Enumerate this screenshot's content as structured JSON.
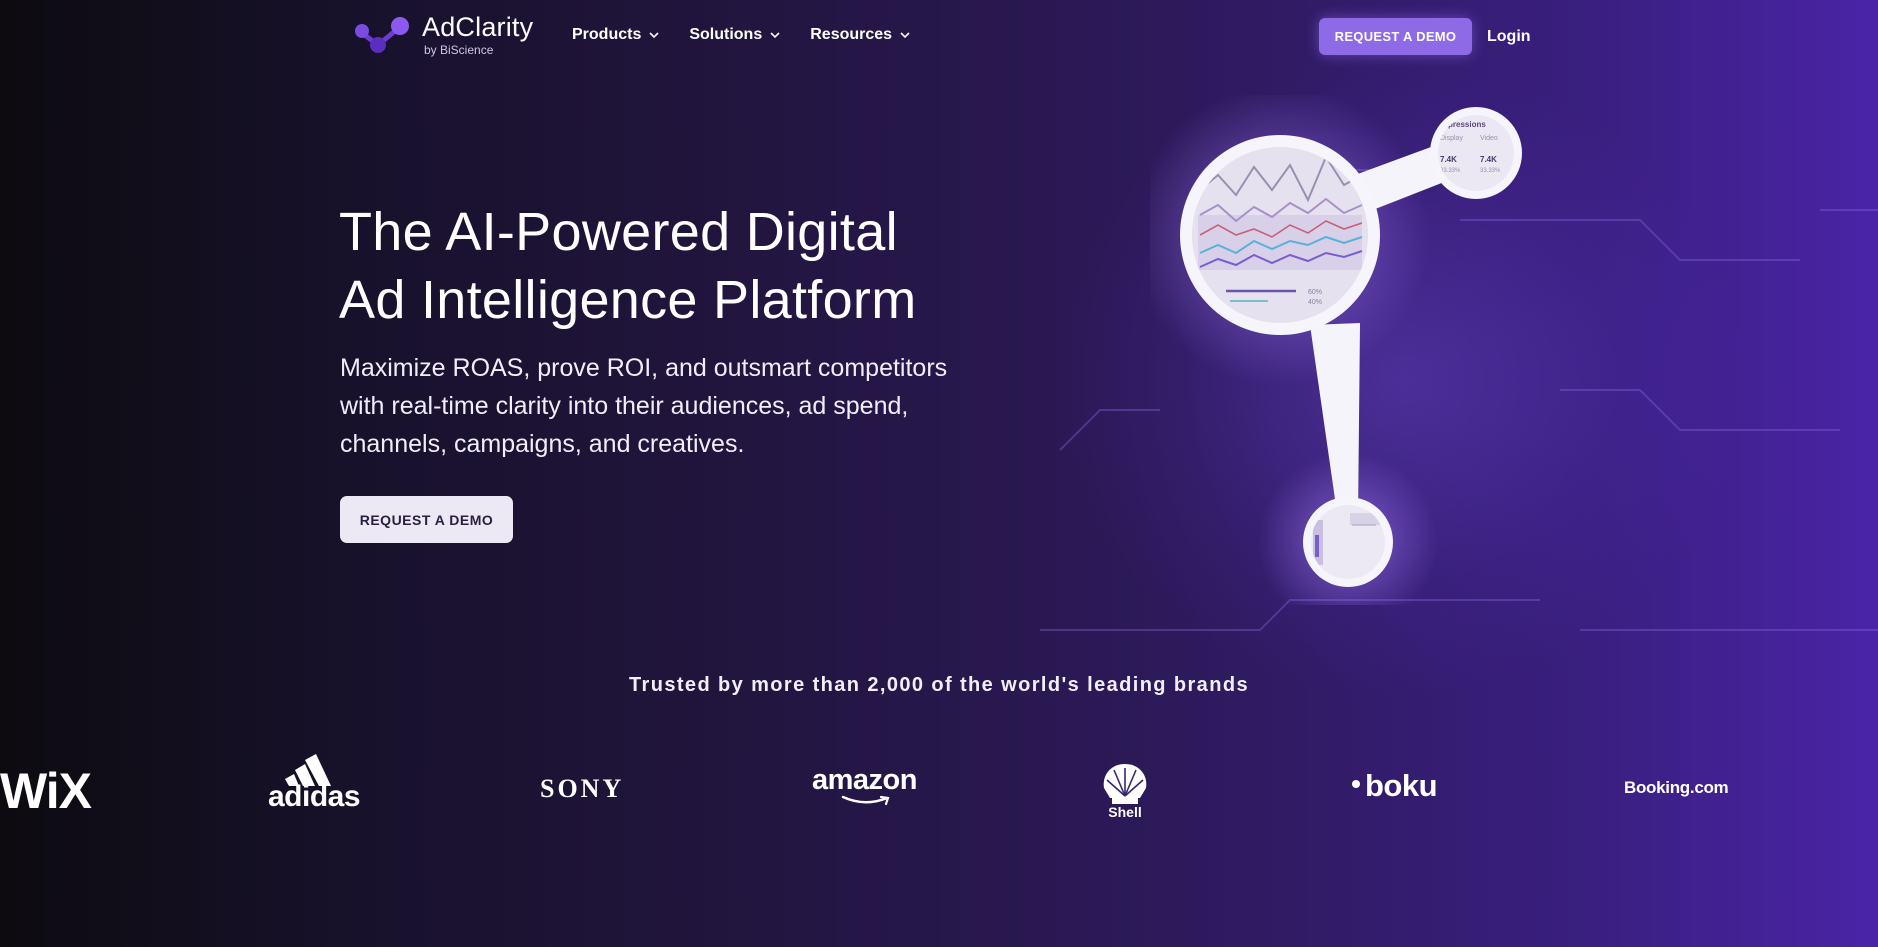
{
  "nav": {
    "logo": {
      "name": "AdClarity",
      "sub": "by BiScience"
    },
    "menu": [
      {
        "label": "Products"
      },
      {
        "label": "Solutions"
      },
      {
        "label": "Resources"
      }
    ],
    "cta_label": "REQUEST A DEMO",
    "login_label": "Login"
  },
  "hero": {
    "title_line1": "The AI-Powered Digital",
    "title_line2": "Ad Intelligence Platform",
    "sub_line1": "Maximize ROAS, prove ROI, and outsmart competitors",
    "sub_line2": "with real-time clarity into their audiences, ad spend,",
    "sub_line3": "channels, campaigns, and creatives.",
    "cta_label": "REQUEST A DEMO"
  },
  "illustration": {
    "big_circle": {
      "legend_values": [
        "60%",
        "40%"
      ]
    },
    "small_circle": {
      "heading": "pressions",
      "col1": "Display",
      "col2": "Video",
      "val1": "7.4K",
      "val2": "7.4K",
      "pct1": "33.33%",
      "pct2": "33.33%"
    }
  },
  "trusted": {
    "heading": "Trusted by more than 2,000 of the world's leading brands",
    "brands": [
      {
        "name": "WiX"
      },
      {
        "name": "adidas"
      },
      {
        "name": "SONY"
      },
      {
        "name": "amazon"
      },
      {
        "name": "Shell"
      },
      {
        "name": "boku"
      },
      {
        "name": "Booking.com"
      }
    ]
  },
  "colors": {
    "accent": "#8f6ae6",
    "bg_dark": "#0d0b10",
    "bg_purple": "#4a24a6",
    "button_light": "#ece8f4"
  }
}
